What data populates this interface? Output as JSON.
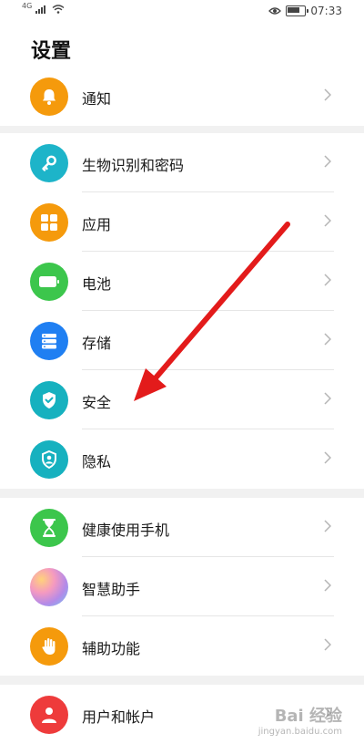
{
  "status_bar": {
    "network": "4G",
    "time": "07:33"
  },
  "page": {
    "title": "设置"
  },
  "groups": [
    {
      "items": [
        {
          "label": "通知",
          "icon": "bell-icon",
          "color": "#f59a0c"
        }
      ]
    },
    {
      "items": [
        {
          "label": "生物识别和密码",
          "icon": "key-icon",
          "color": "#1db4c9"
        },
        {
          "label": "应用",
          "icon": "apps-grid-icon",
          "color": "#f59a0c"
        },
        {
          "label": "电池",
          "icon": "battery-icon",
          "color": "#3cc64c"
        },
        {
          "label": "存储",
          "icon": "storage-icon",
          "color": "#1f7ff2"
        },
        {
          "label": "安全",
          "icon": "shield-check-icon",
          "color": "#16b1bf"
        },
        {
          "label": "隐私",
          "icon": "privacy-shield-icon",
          "color": "#16b1bf"
        }
      ]
    },
    {
      "items": [
        {
          "label": "健康使用手机",
          "icon": "hourglass-icon",
          "color": "#3cc64c"
        },
        {
          "label": "智慧助手",
          "icon": "assistant-orb-icon",
          "color": "#c8a0e8"
        },
        {
          "label": "辅助功能",
          "icon": "hand-icon",
          "color": "#f59a0c"
        }
      ]
    },
    {
      "items": [
        {
          "label": "用户和帐户",
          "icon": "user-icon",
          "color": "#ee3b3b"
        }
      ]
    }
  ],
  "annotation": {
    "arrow_color": "#e31b1b"
  },
  "watermark": {
    "logo": "Bai 经验",
    "url": "jingyan.baidu.com"
  }
}
